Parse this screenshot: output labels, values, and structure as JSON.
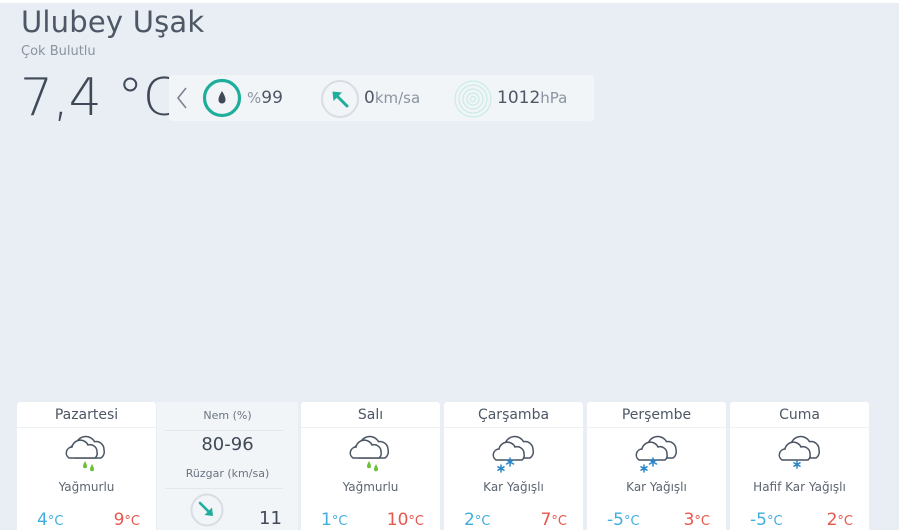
{
  "location": {
    "name": "Ulubey Uşak",
    "condition": "Çok Bulutlu"
  },
  "current": {
    "temperature": "7,4 °C",
    "humidity_prefix": "%",
    "humidity": "99",
    "wind_value": "0",
    "wind_unit": "km/sa",
    "pressure_value": "1012",
    "pressure_unit": "hPa"
  },
  "forecast": [
    {
      "day": "Pazartesi",
      "desc": "Yağmurlu",
      "low": "4",
      "high": "9",
      "unit": "°C",
      "icon": "rain-cloud-icon"
    },
    {
      "day": "Salı",
      "desc": "Yağmurlu",
      "low": "1",
      "high": "10",
      "unit": "°C",
      "icon": "rain-cloud-icon"
    },
    {
      "day": "Çarşamba",
      "desc": "Kar Yağışlı",
      "low": "2",
      "high": "7",
      "unit": "°C",
      "icon": "snow-cloud-icon"
    },
    {
      "day": "Perşembe",
      "desc": "Kar Yağışlı",
      "low": "-5",
      "high": "3",
      "unit": "°C",
      "icon": "snow-cloud-icon"
    },
    {
      "day": "Cuma",
      "desc": "Hafif Kar Yağışlı",
      "low": "-5",
      "high": "2",
      "unit": "°C",
      "icon": "light-snow-cloud-icon"
    }
  ],
  "detail": {
    "humidity_label": "Nem (%)",
    "humidity_value": "80-96",
    "wind_label": "Rüzgar (km/sa)",
    "wind_value": "11"
  },
  "colors": {
    "teal": "#1fae9b",
    "low_temp": "#41aee0",
    "high_temp": "#e8574d",
    "rain_drop": "#6fbf3b",
    "snow": "#2a86c9"
  }
}
